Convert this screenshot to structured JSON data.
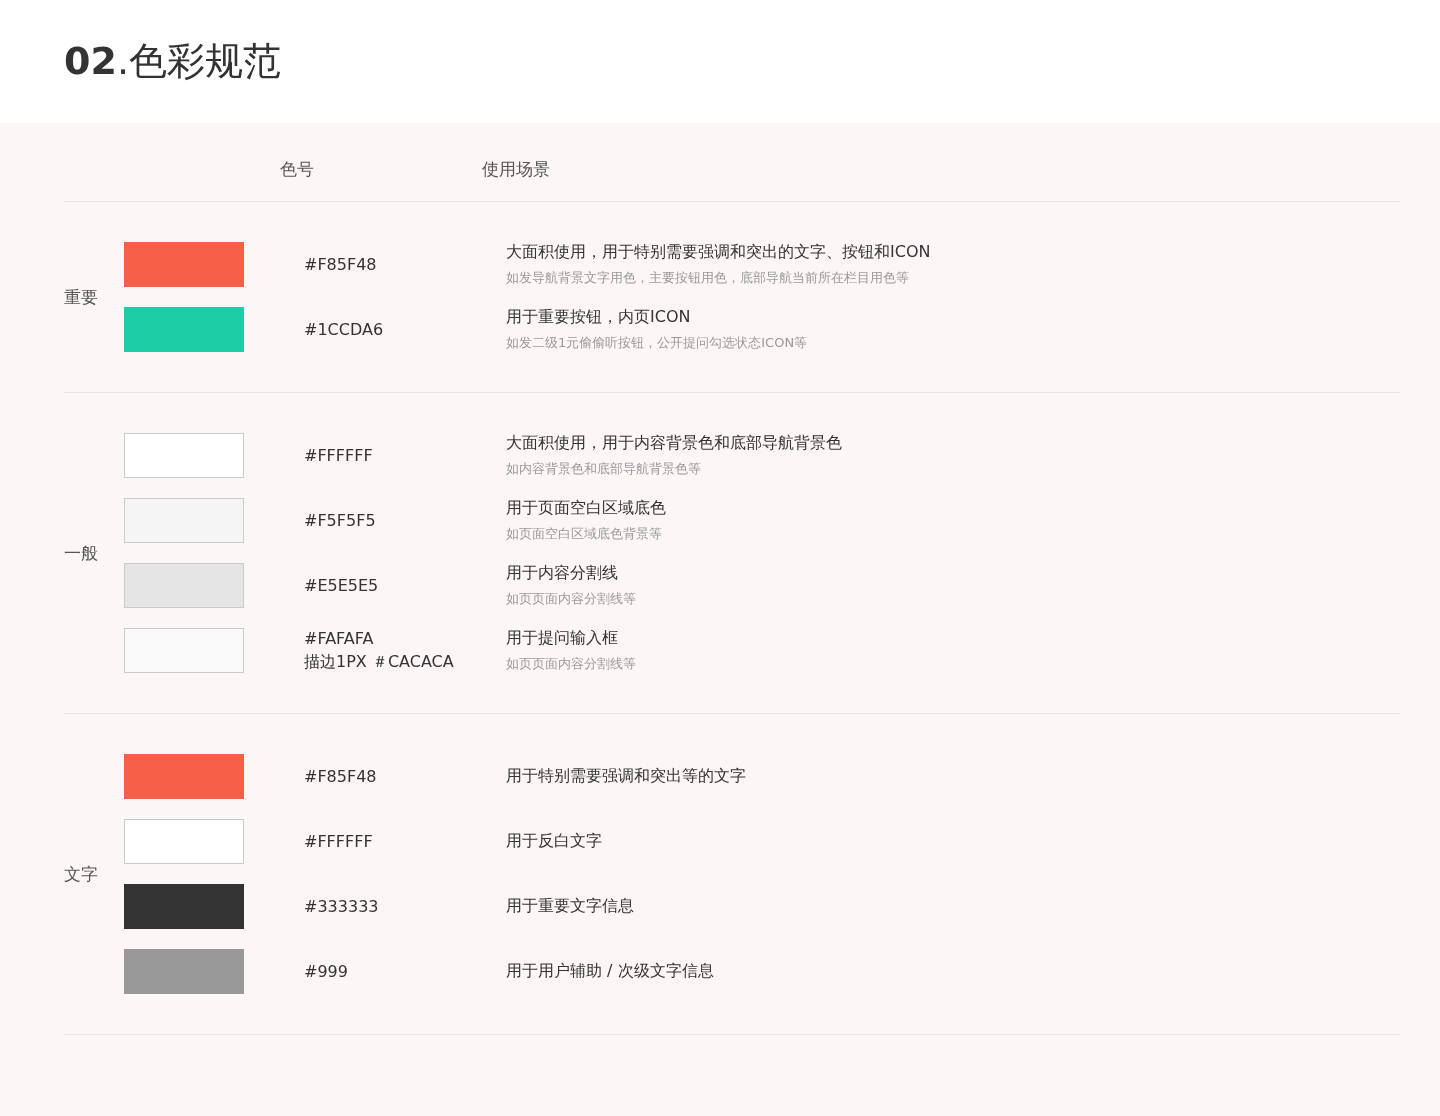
{
  "title": "**02**.色彩规范",
  "columns": [
    "色号",
    "使用场景"
  ],
  "groups": [
    {
      "label": "重要",
      "rows": [
        {
          "color": "#f85f48",
          "bordered": false,
          "code": [
            "#F85F48"
          ],
          "usage": "大面积使用，用于特别需要强调和突出的文字、按钮和ICON",
          "note": "如发导航背景文字用色，主要按钮用色，底部导航当前所在栏目用色等"
        },
        {
          "color": "#1ccda6",
          "bordered": false,
          "code": [
            "#1CCDA6"
          ],
          "usage": "用于重要按钮，内页ICON",
          "note": "如发二级1元偷偷听按钮，公开提问勾选状态ICON等"
        }
      ]
    },
    {
      "label": "一般",
      "rows": [
        {
          "color": "#ffffff",
          "bordered": true,
          "code": [
            "#FFFFFF"
          ],
          "usage": "大面积使用，用于内容背景色和底部导航背景色",
          "note": "如内容背景色和底部导航背景色等"
        },
        {
          "color": "#f5f5f5",
          "bordered": true,
          "code": [
            "#F5F5F5"
          ],
          "usage": "用于页面空白区域底色",
          "note": "如页面空白区域底色背景等"
        },
        {
          "color": "#e5e5e5",
          "bordered": true,
          "code": [
            "#E5E5E5"
          ],
          "usage": "用于内容分割线",
          "note": "如页页面内容分割线等"
        },
        {
          "color": "#fafafa",
          "bordered": true,
          "code": [
            "#FAFAFA",
            "描边1PX ＃CACACA"
          ],
          "usage": "用于提问输入框",
          "note": "如页页面内容分割线等"
        }
      ]
    },
    {
      "label": "文字",
      "rows": [
        {
          "color": "#f85f48",
          "bordered": false,
          "code": [
            "#F85F48"
          ],
          "usage": "用于特别需要强调和突出等的文字"
        },
        {
          "color": "#ffffff",
          "bordered": true,
          "code": [
            "#FFFFFF"
          ],
          "usage": "用于反白文字"
        },
        {
          "color": "#333333",
          "bordered": false,
          "code": [
            "#333333"
          ],
          "usage": "用于重要文字信息"
        },
        {
          "color": "#999999",
          "bordered": false,
          "code": [
            "#999"
          ],
          "usage": "用于用户辅助 / 次级文字信息"
        }
      ]
    }
  ]
}
